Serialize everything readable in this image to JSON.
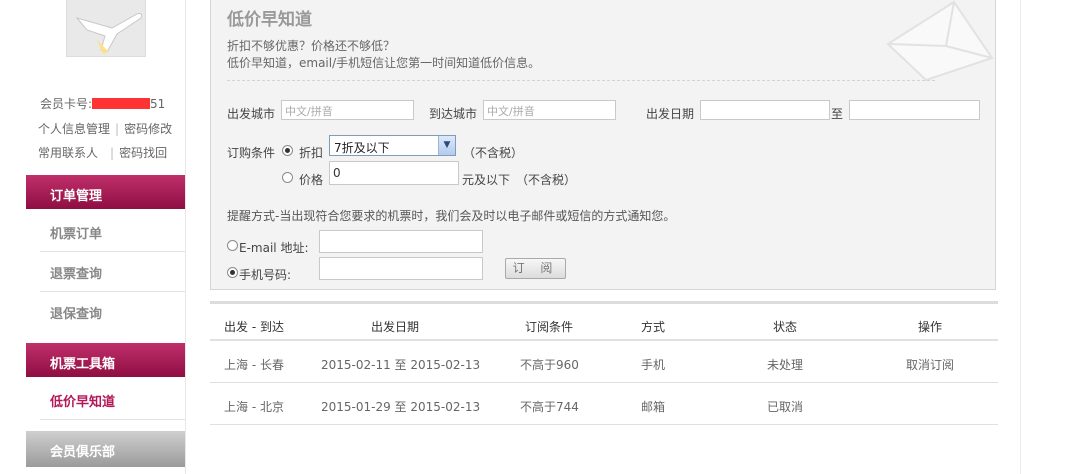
{
  "sidebar": {
    "card_label": "会员卡号:",
    "card_suffix": "51",
    "links": {
      "profile": "个人信息管理",
      "change_password": "密码修改",
      "contacts": "常用联系人",
      "recover_password": "密码找回"
    },
    "sections": [
      {
        "title": "订单管理",
        "items": [
          "机票订单",
          "退票查询",
          "退保查询"
        ]
      },
      {
        "title": "机票工具箱",
        "items": [
          "低价早知道"
        ]
      },
      {
        "title": "会员俱乐部"
      }
    ],
    "active_item": "低价早知道",
    "colors": {
      "section_header": "#b31859",
      "club_header": "#a9a9a9"
    }
  },
  "form": {
    "title": "低价早知道",
    "subtitle_line1": "折扣不够优惠？价格还不够低？",
    "subtitle_line2": "低价早知道，email/手机短信让您第一时间知道低价信息。",
    "departure_city": {
      "label": "出发城市",
      "placeholder": "中文/拼音"
    },
    "arrival_city": {
      "label": "到达城市",
      "placeholder": "中文/拼音"
    },
    "departure_date": {
      "label": "出发日期",
      "to_label": "至",
      "from_value": "",
      "to_value": ""
    },
    "condition_label": "订购条件",
    "discount_option": {
      "label": "折扣",
      "selected": true,
      "value": "7折及以下",
      "note": "（不含税）"
    },
    "price_option": {
      "label": "价格",
      "selected": false,
      "value": "0",
      "suffix": "元及以下",
      "note": "（不含税）"
    },
    "notice": "提醒方式-当出现符合您要求的机票时，我们会及时以电子邮件或短信的方式通知您。",
    "email_option": {
      "label": "E-mail 地址:",
      "selected": false,
      "value": ""
    },
    "mobile_option": {
      "label": "手机号码:",
      "selected": true,
      "value": ""
    },
    "submit_label": "订 阅"
  },
  "table": {
    "columns": [
      "出发 - 到达",
      "出发日期",
      "订阅条件",
      "方式",
      "状态",
      "操作"
    ],
    "rows": [
      {
        "route": "上海 - 长春",
        "dates": "2015-02-11 至  2015-02-13",
        "condition": "不高于960",
        "method": "手机",
        "status": "未处理",
        "action": "取消订阅"
      },
      {
        "route": "上海 - 北京",
        "dates": "2015-01-29 至  2015-02-13",
        "condition": "不高于744",
        "method": "邮箱",
        "status": "已取消",
        "action": ""
      }
    ]
  }
}
